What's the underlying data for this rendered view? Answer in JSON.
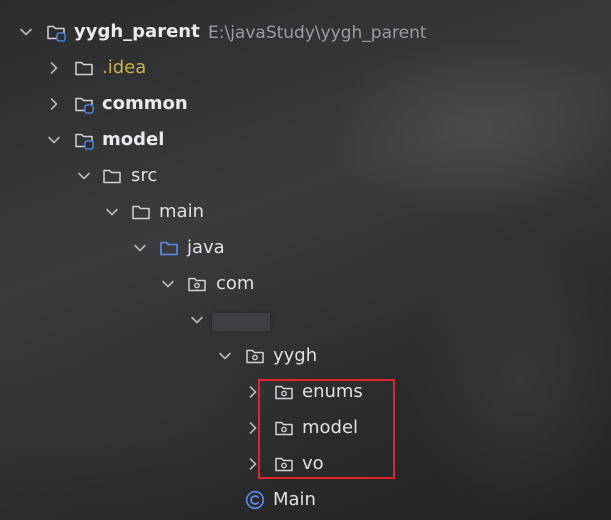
{
  "project_tree": {
    "root": {
      "name": "yygh_parent",
      "path": "E:\\javaStudy\\yygh_parent"
    },
    "items": [
      {
        "label": ".idea"
      },
      {
        "label": "common"
      },
      {
        "label": "model"
      },
      {
        "label": "src"
      },
      {
        "label": "main"
      },
      {
        "label": "java"
      },
      {
        "label": "com"
      },
      {
        "label": ""
      },
      {
        "label": "yygh"
      },
      {
        "label": "enums"
      },
      {
        "label": "model"
      },
      {
        "label": "vo"
      },
      {
        "label": "Main"
      }
    ]
  },
  "colors": {
    "highlight_border": "#e0262b",
    "module_marker": "#4a7fd6",
    "class_icon": "#5b8def",
    "idea_text": "#c9b44a"
  },
  "icons": {
    "expanded": "chevron-down-icon",
    "collapsed": "chevron-right-icon",
    "folder": "folder-icon",
    "module": "module-folder-icon",
    "source_root": "source-root-folder-icon",
    "package": "package-icon",
    "class": "class-icon"
  }
}
